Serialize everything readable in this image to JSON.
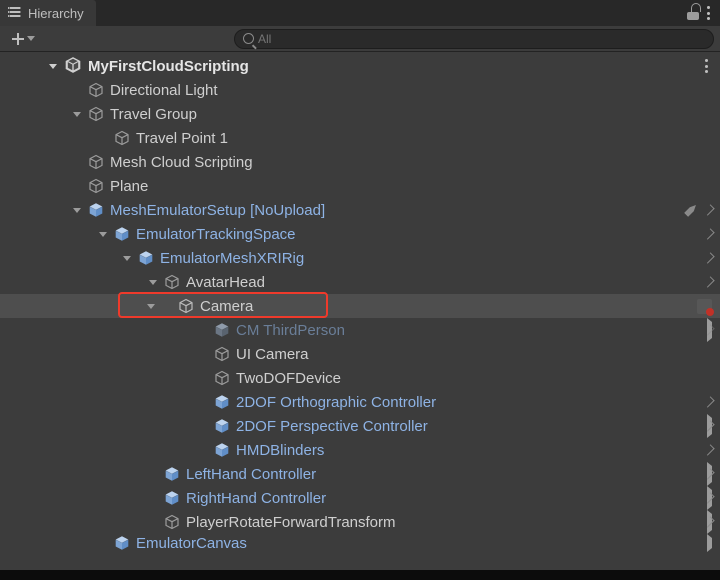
{
  "panel": {
    "title": "Hierarchy"
  },
  "search": {
    "placeholder": "All"
  },
  "scene": "MyFirstCloudScripting",
  "nodes": {
    "dirLight": "Directional Light",
    "travelGroup": "Travel Group",
    "travelPoint1": "Travel Point 1",
    "meshCloudScripting": "Mesh Cloud Scripting",
    "plane": "Plane",
    "meshEmulatorSetup": "MeshEmulatorSetup [NoUpload]",
    "emulatorTrackingSpace": "EmulatorTrackingSpace",
    "emulatorMeshXRIRig": "EmulatorMeshXRIRig",
    "avatarHead": "AvatarHead",
    "camera": "Camera",
    "cmThirdPerson": "CM ThirdPerson",
    "uiCamera": "UI Camera",
    "twoDofDevice": "TwoDOFDevice",
    "twoDofOrtho": "2DOF Orthographic Controller",
    "twoDofPersp": "2DOF Perspective Controller",
    "hmdBlinders": "HMDBlinders",
    "leftHand": "LeftHand Controller",
    "rightHand": "RightHand Controller",
    "playerRotate": "PlayerRotateForwardTransform",
    "emulatorCanvas": "EmulatorCanvas"
  },
  "colors": {
    "prefab": "#8eb3e5",
    "inactive": "#6a7e98",
    "selection": "#4e4e4e",
    "highlight": "#ef3a2b"
  }
}
